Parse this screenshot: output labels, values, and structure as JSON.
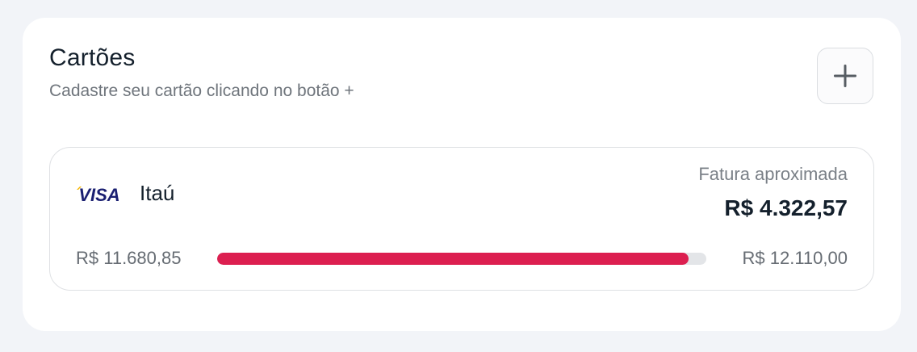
{
  "section": {
    "title": "Cartões",
    "subtitle": "Cadastre seu cartão clicando no botão +",
    "add_button_icon": "plus-icon"
  },
  "card": {
    "brand": "VISA",
    "brand_icon": "visa-logo",
    "bank": "Itaú",
    "invoice_label": "Fatura aproximada",
    "invoice_value": "R$ 4.322,57",
    "used": "R$ 11.680,85",
    "limit": "R$ 12.110,00",
    "usage_fraction": 0.9645,
    "usage_color": "#dc1f50"
  },
  "colors": {
    "background": "#f2f4f8",
    "panel": "#ffffff",
    "text_primary": "#14202c",
    "text_secondary": "#6f757c",
    "visa_blue": "#1a1f71",
    "visa_gold": "#f7b600"
  }
}
